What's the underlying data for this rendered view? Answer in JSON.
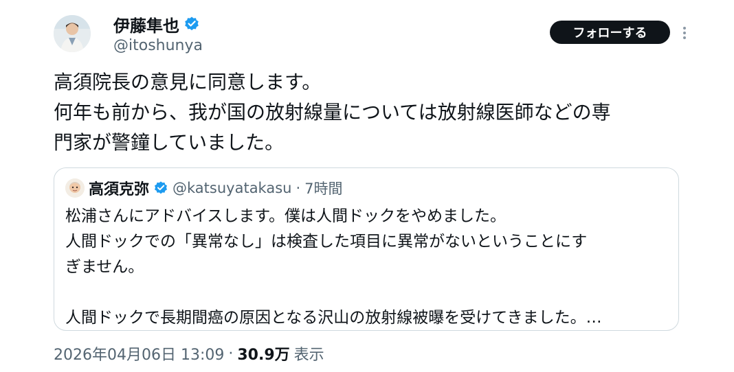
{
  "author": {
    "name": "伊藤隼也",
    "handle": "@itoshunya",
    "verified_color": "#1d9bf0"
  },
  "actions": {
    "follow_label": "フォローする",
    "more_icon": "more-dots-icon"
  },
  "tweet": {
    "lines": [
      "高須院長の意見に同意します。",
      "何年も前から、我が国の放射線量については放射線医師などの専",
      "門家が警鐘していました。"
    ]
  },
  "quote": {
    "name": "高須克弥",
    "handle": "@katsuyatakasu",
    "separator": "·",
    "time": "7時間",
    "lines": [
      "松浦さんにアドバイスします。僕は人間ドックをやめました。",
      "人間ドックでの「異常なし」は検査した項目に異常がないということにす",
      "ぎません。",
      "",
      "人間ドックで長期間癌の原因となる沢山の放射線被曝を受けてきました。…"
    ]
  },
  "meta": {
    "timestamp": "2026年04月06日 13:09",
    "separator": "·",
    "views": "30.9万",
    "views_label": "表示"
  },
  "colors": {
    "text": "#0f1419",
    "secondary": "#536471",
    "border": "#cfd9de",
    "button_bg": "#0f1419"
  }
}
